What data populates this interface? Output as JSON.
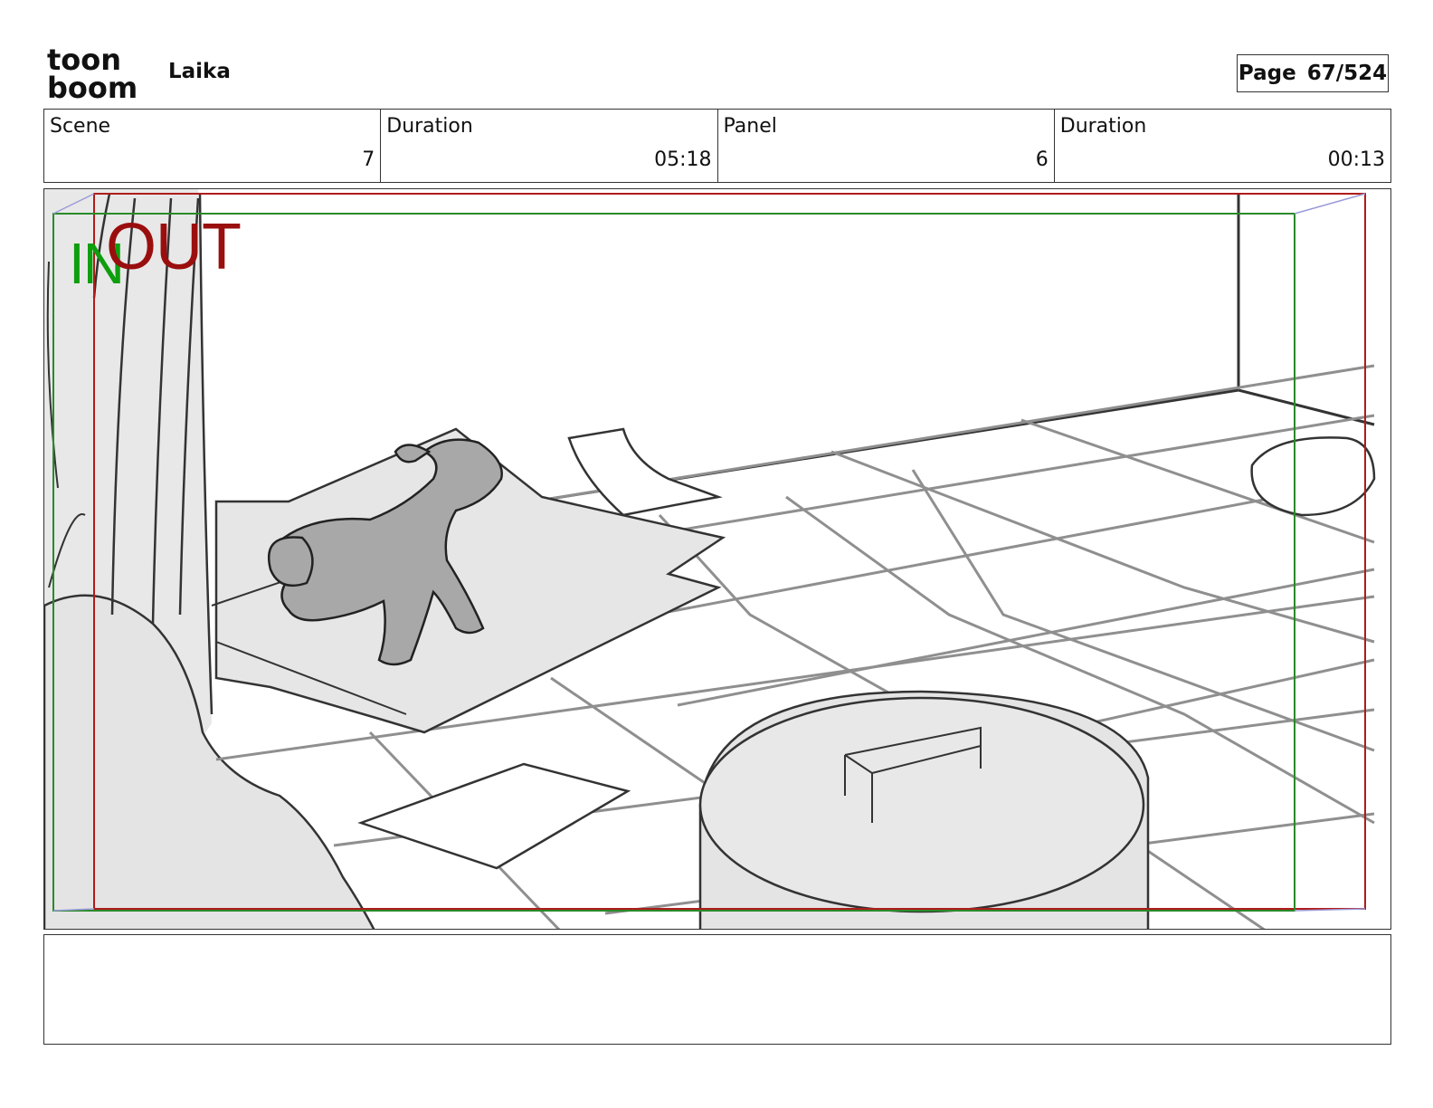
{
  "header": {
    "logo_text_top": "toon",
    "logo_text_bottom": "boom",
    "project_title": "Laika",
    "page_label": "Page",
    "page_number": "67/524"
  },
  "info": {
    "scene_label": "Scene",
    "scene_value": "7",
    "scene_duration_label": "Duration",
    "scene_duration_value": "05:18",
    "panel_label": "Panel",
    "panel_value": "6",
    "panel_duration_label": "Duration",
    "panel_duration_value": "00:13"
  },
  "panel_frame": {
    "in_label": "IN",
    "out_label": "OUT",
    "in_color": "#0e9e0e",
    "out_color": "#9b0e0e"
  },
  "notes": {
    "text": ""
  }
}
